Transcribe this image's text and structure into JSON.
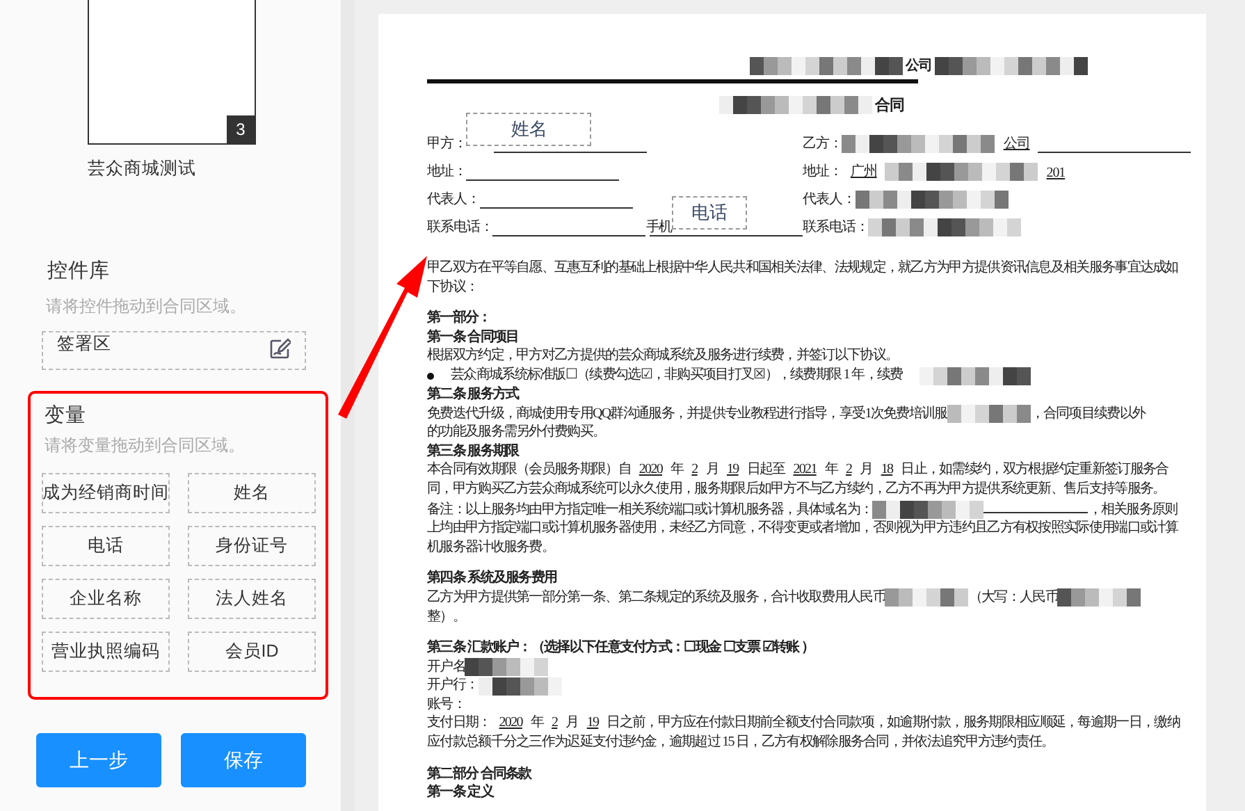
{
  "sidebar": {
    "thumbnail": {
      "page_number": "3",
      "caption": "芸众商城测试"
    },
    "controls": {
      "title": "控件库",
      "hint": "请将控件拖动到合同区域。",
      "items": [
        {
          "label": "签署区"
        }
      ]
    },
    "variables": {
      "title": "变量",
      "hint": "请将变量拖动到合同区域。",
      "items": [
        {
          "label": "成为经销商时间"
        },
        {
          "label": "姓名"
        },
        {
          "label": "电话"
        },
        {
          "label": "身份证号"
        },
        {
          "label": "企业名称"
        },
        {
          "label": "法人姓名"
        },
        {
          "label": "营业执照编码"
        },
        {
          "label": "会员ID"
        }
      ]
    },
    "buttons": [
      {
        "label": "上一步"
      },
      {
        "label": "保存"
      }
    ]
  },
  "document": {
    "header": [
      {
        "kind": "redacted"
      },
      {
        "kind": "text",
        "text": "公司"
      },
      {
        "kind": "redacted"
      }
    ],
    "title": [
      {
        "kind": "redacted"
      },
      {
        "kind": "text",
        "text": "合同"
      }
    ],
    "parties": [
      [
        {
          "label": "甲方：",
          "segments": [
            {
              "kind": "variable",
              "text": "姓名"
            },
            {
              "kind": "blank"
            }
          ]
        },
        {
          "label": "乙方：",
          "segments": [
            {
              "kind": "redacted"
            },
            {
              "kind": "value",
              "text": "公司"
            },
            {
              "kind": "blank"
            }
          ]
        }
      ],
      [
        {
          "label": "地址：",
          "segments": [
            {
              "kind": "blank"
            }
          ]
        },
        {
          "label": "地址：",
          "segments": [
            {
              "kind": "value",
              "text": "广州"
            },
            {
              "kind": "redacted"
            },
            {
              "kind": "value",
              "text": "201"
            }
          ]
        }
      ],
      [
        {
          "label": "代表人：",
          "segments": [
            {
              "kind": "blank"
            }
          ]
        },
        {
          "label": "代表人：",
          "segments": [
            {
              "kind": "redacted"
            }
          ]
        }
      ],
      [
        {
          "label": "联系电话：",
          "segments": [
            {
              "kind": "blank"
            },
            {
              "kind": "text",
              "text": "手机"
            },
            {
              "kind": "variable",
              "text": "电话"
            },
            {
              "kind": "blank"
            }
          ]
        },
        {
          "label": "联系电话：",
          "segments": [
            {
              "kind": "redacted"
            }
          ]
        }
      ]
    ],
    "blocks": [
      {
        "kind": "para",
        "segments": [
          {
            "kind": "text",
            "text": "甲乙双方在平等自愿、互惠互利的基础上根据中华人民共和国相关法律、法规规定，就乙方为甲方提供资讯信息及相关服务事宜达成如下协议："
          }
        ]
      },
      {
        "kind": "gap"
      },
      {
        "kind": "heading",
        "segments": [
          {
            "kind": "text",
            "text": "第一部分："
          }
        ]
      },
      {
        "kind": "heading",
        "segments": [
          {
            "kind": "text",
            "text": "第一条  合同项目"
          }
        ]
      },
      {
        "kind": "para",
        "segments": [
          {
            "kind": "text",
            "text": "根据双方约定，甲方对乙方提供的芸众商城系统及服务进行续费，并签订以下协议。"
          }
        ]
      },
      {
        "kind": "bullet",
        "segments": [
          {
            "kind": "text",
            "text": "芸众商城系统标准版☐（续费勾选☑，非购买项目打叉☒），续费期限 1 年，续费"
          },
          {
            "kind": "redacted"
          }
        ]
      },
      {
        "kind": "heading",
        "segments": [
          {
            "kind": "text",
            "text": "第二条  服务方式"
          }
        ]
      },
      {
        "kind": "line",
        "segments": [
          {
            "kind": "text",
            "text": "免费迭代升级，商城使用专用QQ群沟通服务，并提供专业教程进行指导，享受1次免费培训服"
          },
          {
            "kind": "redacted"
          },
          {
            "kind": "text",
            "text": "，合同项目续费以外"
          }
        ]
      },
      {
        "kind": "para",
        "segments": [
          {
            "kind": "text",
            "text": "的功能及服务需另外付费购买。"
          }
        ]
      },
      {
        "kind": "heading",
        "segments": [
          {
            "kind": "text",
            "text": "第三条  服务期限"
          }
        ]
      },
      {
        "kind": "para",
        "segments": [
          {
            "kind": "text",
            "text": "本合同有效期限（会员服务期限）自"
          },
          {
            "kind": "value",
            "text": "2020"
          },
          {
            "kind": "text",
            "text": "年"
          },
          {
            "kind": "value",
            "text": "2"
          },
          {
            "kind": "text",
            "text": "月"
          },
          {
            "kind": "value",
            "text": "19"
          },
          {
            "kind": "text",
            "text": "日起至"
          },
          {
            "kind": "value",
            "text": "2021"
          },
          {
            "kind": "text",
            "text": "年"
          },
          {
            "kind": "value",
            "text": "2"
          },
          {
            "kind": "text",
            "text": "月"
          },
          {
            "kind": "value",
            "text": "18"
          },
          {
            "kind": "text",
            "text": "日止，如需续约，双方根据约定重新签订服务合同，甲方购买乙方芸众商城系统可以永久使用，服务期限后如甲方不与乙方续约，乙方不再为甲方提供系统更新、售后支持等服务。"
          }
        ]
      },
      {
        "kind": "para",
        "segments": [
          {
            "kind": "text",
            "text": "备注：以上服务均由甲方指定唯一相关系统端口或计算机服务器，具体域名为："
          },
          {
            "kind": "redacted"
          },
          {
            "kind": "blank"
          },
          {
            "kind": "text",
            "text": "，相关服务原则上均由甲方指定端口或计算机服务器使用，未经乙方同意，不得变更或者增加，否则视为甲方违约且乙方有权按照实际使用端口或计算机服务器计收服务费。"
          }
        ]
      },
      {
        "kind": "gap"
      },
      {
        "kind": "heading",
        "segments": [
          {
            "kind": "text",
            "text": "第四条  系统及服务费用"
          }
        ]
      },
      {
        "kind": "line",
        "segments": [
          {
            "kind": "text",
            "text": "乙方为甲方提供第一部分第一条、第二条规定的系统及服务，合计收取费用人民币"
          },
          {
            "kind": "redacted"
          },
          {
            "kind": "text",
            "text": "（大写：人民币"
          },
          {
            "kind": "redacted"
          }
        ]
      },
      {
        "kind": "para",
        "segments": [
          {
            "kind": "text",
            "text": "整）。"
          }
        ]
      },
      {
        "kind": "gap"
      },
      {
        "kind": "heading",
        "segments": [
          {
            "kind": "text",
            "text": "第三条    汇款账户：（选择以下任意支付方式：☐现金      ☐支票      ☑转账   ）"
          }
        ]
      },
      {
        "kind": "line",
        "segments": [
          {
            "kind": "text",
            "text": "开户名"
          },
          {
            "kind": "redacted"
          }
        ]
      },
      {
        "kind": "line",
        "segments": [
          {
            "kind": "text",
            "text": "开户行："
          },
          {
            "kind": "redacted"
          }
        ]
      },
      {
        "kind": "para",
        "segments": [
          {
            "kind": "text",
            "text": "账号："
          }
        ]
      },
      {
        "kind": "para",
        "segments": [
          {
            "kind": "text",
            "text": "支付日期："
          },
          {
            "kind": "value",
            "text": "2020"
          },
          {
            "kind": "text",
            "text": "年"
          },
          {
            "kind": "value",
            "text": "2"
          },
          {
            "kind": "text",
            "text": "月"
          },
          {
            "kind": "value",
            "text": "19"
          },
          {
            "kind": "text",
            "text": "日之前，甲方应在付款日期前全额支付合同款项，如逾期付款，服务期限相应顺延，每逾期一日，缴纳应付款总额千分之三作为迟延支付违约金，逾期超过 15 日，乙方有权解除服务合同，并依法追究甲方违约责任。"
          }
        ]
      },
      {
        "kind": "gap"
      },
      {
        "kind": "heading",
        "segments": [
          {
            "kind": "text",
            "text": "第二部分  合同条款"
          }
        ]
      },
      {
        "kind": "heading",
        "segments": [
          {
            "kind": "text",
            "text": "第一条    定义"
          }
        ]
      }
    ]
  }
}
